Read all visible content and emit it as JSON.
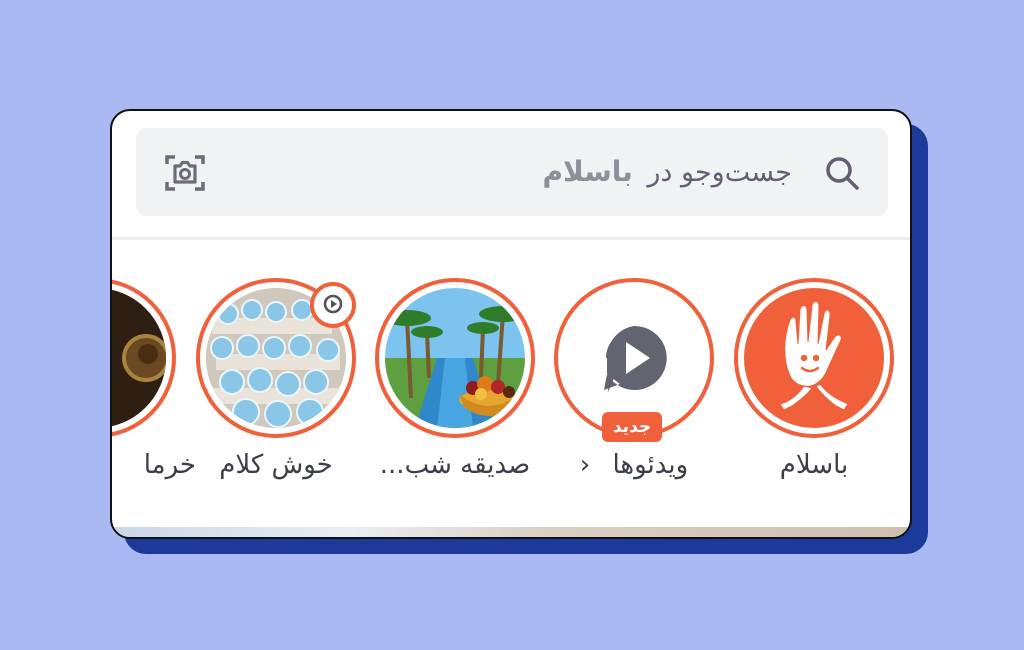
{
  "search": {
    "placeholder": "جست‌وجو در",
    "brand": "باسلام",
    "search_icon": "search-icon",
    "camera_icon": "camera-icon"
  },
  "stories": [
    {
      "label": "باسلام",
      "icon": "waving-hand-logo"
    },
    {
      "label": "ویدئوها",
      "chevron": "‹",
      "badge": "جدید",
      "icon": "video-play-icon"
    },
    {
      "label": "صدیقه شب...",
      "icon": "oasis-image"
    },
    {
      "label": "خوش کلام",
      "icon": "cupcakes-image",
      "badge_icon": "video-play-icon"
    },
    {
      "label": "خرما",
      "icon": "dates-image"
    }
  ],
  "colors": {
    "accent": "#f0603a",
    "background": "#abb9f2",
    "card_shadow": "#1d3a9a",
    "search_bg": "#f1f2f4"
  }
}
